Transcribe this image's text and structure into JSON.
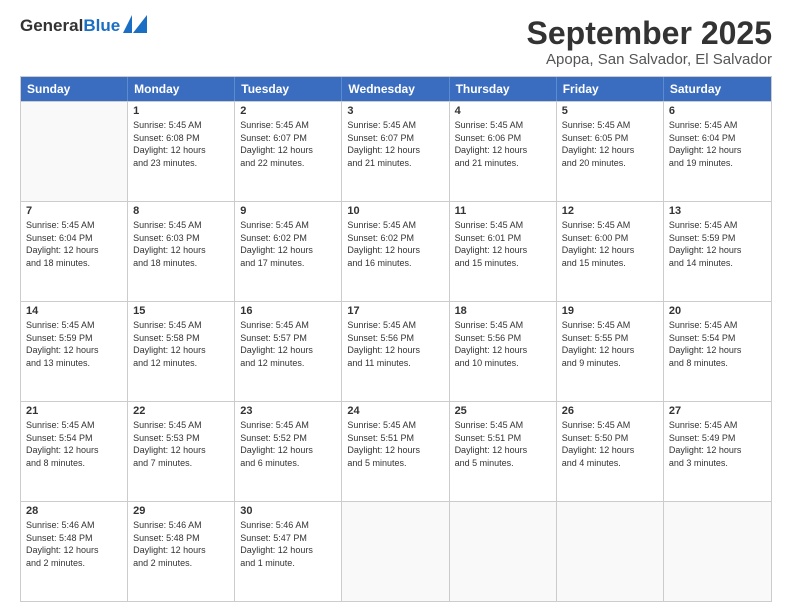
{
  "logo": {
    "general": "General",
    "blue": "Blue"
  },
  "title": "September 2025",
  "location": "Apopa, San Salvador, El Salvador",
  "weekdays": [
    "Sunday",
    "Monday",
    "Tuesday",
    "Wednesday",
    "Thursday",
    "Friday",
    "Saturday"
  ],
  "weeks": [
    [
      {
        "day": "",
        "info": ""
      },
      {
        "day": "1",
        "info": "Sunrise: 5:45 AM\nSunset: 6:08 PM\nDaylight: 12 hours\nand 23 minutes."
      },
      {
        "day": "2",
        "info": "Sunrise: 5:45 AM\nSunset: 6:07 PM\nDaylight: 12 hours\nand 22 minutes."
      },
      {
        "day": "3",
        "info": "Sunrise: 5:45 AM\nSunset: 6:07 PM\nDaylight: 12 hours\nand 21 minutes."
      },
      {
        "day": "4",
        "info": "Sunrise: 5:45 AM\nSunset: 6:06 PM\nDaylight: 12 hours\nand 21 minutes."
      },
      {
        "day": "5",
        "info": "Sunrise: 5:45 AM\nSunset: 6:05 PM\nDaylight: 12 hours\nand 20 minutes."
      },
      {
        "day": "6",
        "info": "Sunrise: 5:45 AM\nSunset: 6:04 PM\nDaylight: 12 hours\nand 19 minutes."
      }
    ],
    [
      {
        "day": "7",
        "info": "Sunrise: 5:45 AM\nSunset: 6:04 PM\nDaylight: 12 hours\nand 18 minutes."
      },
      {
        "day": "8",
        "info": "Sunrise: 5:45 AM\nSunset: 6:03 PM\nDaylight: 12 hours\nand 18 minutes."
      },
      {
        "day": "9",
        "info": "Sunrise: 5:45 AM\nSunset: 6:02 PM\nDaylight: 12 hours\nand 17 minutes."
      },
      {
        "day": "10",
        "info": "Sunrise: 5:45 AM\nSunset: 6:02 PM\nDaylight: 12 hours\nand 16 minutes."
      },
      {
        "day": "11",
        "info": "Sunrise: 5:45 AM\nSunset: 6:01 PM\nDaylight: 12 hours\nand 15 minutes."
      },
      {
        "day": "12",
        "info": "Sunrise: 5:45 AM\nSunset: 6:00 PM\nDaylight: 12 hours\nand 15 minutes."
      },
      {
        "day": "13",
        "info": "Sunrise: 5:45 AM\nSunset: 5:59 PM\nDaylight: 12 hours\nand 14 minutes."
      }
    ],
    [
      {
        "day": "14",
        "info": "Sunrise: 5:45 AM\nSunset: 5:59 PM\nDaylight: 12 hours\nand 13 minutes."
      },
      {
        "day": "15",
        "info": "Sunrise: 5:45 AM\nSunset: 5:58 PM\nDaylight: 12 hours\nand 12 minutes."
      },
      {
        "day": "16",
        "info": "Sunrise: 5:45 AM\nSunset: 5:57 PM\nDaylight: 12 hours\nand 12 minutes."
      },
      {
        "day": "17",
        "info": "Sunrise: 5:45 AM\nSunset: 5:56 PM\nDaylight: 12 hours\nand 11 minutes."
      },
      {
        "day": "18",
        "info": "Sunrise: 5:45 AM\nSunset: 5:56 PM\nDaylight: 12 hours\nand 10 minutes."
      },
      {
        "day": "19",
        "info": "Sunrise: 5:45 AM\nSunset: 5:55 PM\nDaylight: 12 hours\nand 9 minutes."
      },
      {
        "day": "20",
        "info": "Sunrise: 5:45 AM\nSunset: 5:54 PM\nDaylight: 12 hours\nand 8 minutes."
      }
    ],
    [
      {
        "day": "21",
        "info": "Sunrise: 5:45 AM\nSunset: 5:54 PM\nDaylight: 12 hours\nand 8 minutes."
      },
      {
        "day": "22",
        "info": "Sunrise: 5:45 AM\nSunset: 5:53 PM\nDaylight: 12 hours\nand 7 minutes."
      },
      {
        "day": "23",
        "info": "Sunrise: 5:45 AM\nSunset: 5:52 PM\nDaylight: 12 hours\nand 6 minutes."
      },
      {
        "day": "24",
        "info": "Sunrise: 5:45 AM\nSunset: 5:51 PM\nDaylight: 12 hours\nand 5 minutes."
      },
      {
        "day": "25",
        "info": "Sunrise: 5:45 AM\nSunset: 5:51 PM\nDaylight: 12 hours\nand 5 minutes."
      },
      {
        "day": "26",
        "info": "Sunrise: 5:45 AM\nSunset: 5:50 PM\nDaylight: 12 hours\nand 4 minutes."
      },
      {
        "day": "27",
        "info": "Sunrise: 5:45 AM\nSunset: 5:49 PM\nDaylight: 12 hours\nand 3 minutes."
      }
    ],
    [
      {
        "day": "28",
        "info": "Sunrise: 5:46 AM\nSunset: 5:48 PM\nDaylight: 12 hours\nand 2 minutes."
      },
      {
        "day": "29",
        "info": "Sunrise: 5:46 AM\nSunset: 5:48 PM\nDaylight: 12 hours\nand 2 minutes."
      },
      {
        "day": "30",
        "info": "Sunrise: 5:46 AM\nSunset: 5:47 PM\nDaylight: 12 hours\nand 1 minute."
      },
      {
        "day": "",
        "info": ""
      },
      {
        "day": "",
        "info": ""
      },
      {
        "day": "",
        "info": ""
      },
      {
        "day": "",
        "info": ""
      }
    ]
  ]
}
